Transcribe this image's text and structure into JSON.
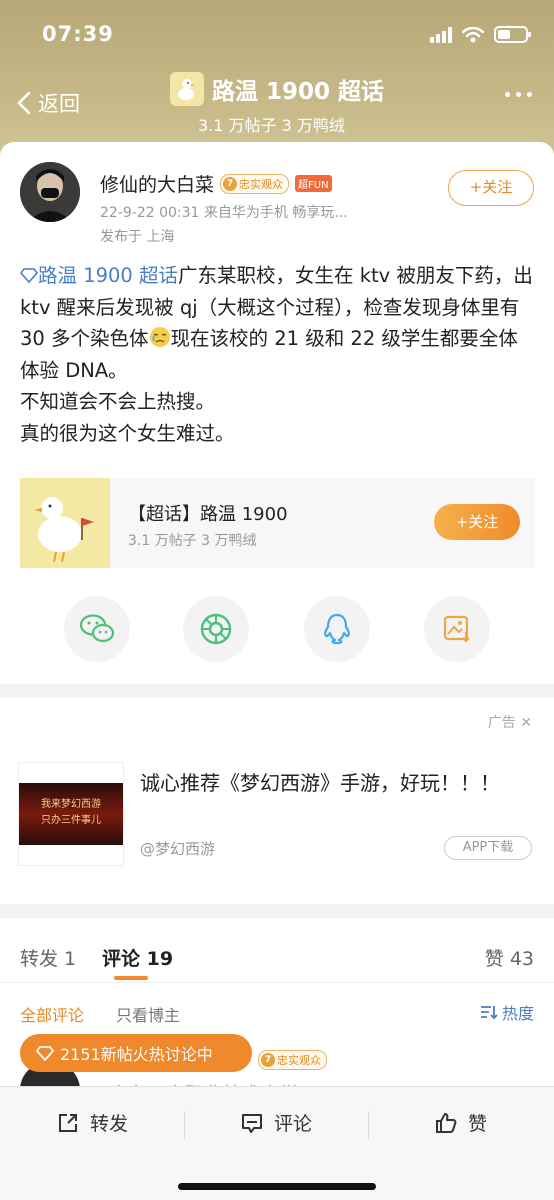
{
  "status": {
    "time": "07:39"
  },
  "nav": {
    "back_label": "返回",
    "topic_name": "路温 1900 超话",
    "topic_stats": "3.1 万帖子  3 万鸭绒"
  },
  "post": {
    "user_name": "修仙的大白菜",
    "fan_badge_level": "7",
    "fan_badge": "忠实观众",
    "super_badge": "超FUN",
    "meta": "22-9-22 00:31  来自华为手机 畅享玩...",
    "location": "发布于 上海",
    "follow_label": "+关注",
    "topic_link": "路温 1900 超话",
    "line1": "广东某职校，女生在 ktv 被朋友下药，出 ktv 醒来后发现被 qj（大概这个过程），检查发现身体里有 30 多个染色体",
    "line1b": "现在该校的 21 级和 22 级学生都要全体体验 DNA。",
    "line2": "不知道会不会上热搜。",
    "line3": "真的很为这个女生难过。"
  },
  "topic_card": {
    "title": "【超话】路温 1900",
    "stats": "3.1 万帖子  3 万鸭绒",
    "follow_label": "+关注"
  },
  "share": [
    "wechat-icon",
    "moments-icon",
    "qq-icon",
    "save-image-icon"
  ],
  "ad": {
    "label": "广告",
    "title": "诚心推荐《梦幻西游》手游，好玩！！！",
    "source": "@梦幻西游",
    "download_label": "APP下载",
    "thumb_line1": "我来梦幻西游",
    "thumb_line2": "只办三件事儿"
  },
  "comments": {
    "tab_repost": "转发 1",
    "tab_comment": "评论 19",
    "tab_likes": "赞 43",
    "filter_all": "全部评论",
    "filter_op": "只看博主",
    "sort_label": "热度",
    "hot_pill": "2151新帖火热讨论中",
    "peek_badge_level": "7",
    "peek_badge": "忠实观众",
    "peek_text": "\"广东工商职业技术大学"
  },
  "bottom_bar": {
    "repost": "转发",
    "comment": "评论",
    "like": "赞"
  },
  "colors": {
    "accent": "#f08a2c",
    "link": "#4b7fc1",
    "header": "#c7b988"
  }
}
